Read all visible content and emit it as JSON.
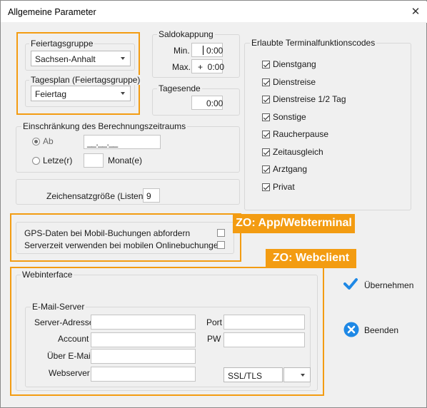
{
  "window": {
    "title": "Allgemeine Parameter",
    "close_glyph": "✕"
  },
  "feiertagsgruppe": {
    "label": "Feiertagsgruppe",
    "value": "Sachsen-Anhalt"
  },
  "tagesplan": {
    "label": "Tagesplan (Feiertagsgruppe)",
    "value": "Feiertag"
  },
  "saldokappung": {
    "label": "Saldokappung",
    "min_label": "Min.",
    "min_value": "0:00",
    "max_label": "Max.",
    "max_value": "+  0:00"
  },
  "tagesende": {
    "label": "Tagesende",
    "value": "0:00"
  },
  "einschraenkung": {
    "label": "Einschränkung des Berechnungszeitraums",
    "ab_label": "Ab",
    "ab_value": "__.__.__",
    "letzte_label": "Letze(r)",
    "letzte_value": "",
    "monat_label": "Monat(e)"
  },
  "zeichensatz": {
    "label": "Zeichensatzgröße (Listen)",
    "value": "9"
  },
  "terminal": {
    "label": "Erlaubte Terminalfunktionscodes",
    "items": [
      {
        "label": "Dienstgang",
        "checked": true
      },
      {
        "label": "Dienstreise",
        "checked": true
      },
      {
        "label": "Dienstreise 1/2 Tag",
        "checked": true
      },
      {
        "label": "Sonstige",
        "checked": true
      },
      {
        "label": "Raucherpause",
        "checked": true
      },
      {
        "label": "Zeitausgleich",
        "checked": true
      },
      {
        "label": "Arztgang",
        "checked": true
      },
      {
        "label": "Privat",
        "checked": true
      }
    ]
  },
  "gps": {
    "label": "GPS-Daten bei Mobil-Buchungen abfordern",
    "checked": false
  },
  "serverzeit": {
    "label": "Serverzeit verwenden bei mobilen Onlinebuchungen",
    "checked": false
  },
  "callouts": {
    "app": "ZO: App/Webterminal",
    "web": "ZO: Webclient"
  },
  "webinterface": {
    "label": "Webinterface",
    "email_label": "E-Mail-Server",
    "server_label": "Server-Adresse",
    "server_value": "",
    "port_label": "Port",
    "port_value": "",
    "account_label": "Account",
    "account_value": "",
    "pw_label": "PW",
    "pw_value": "",
    "ueber_label": "Über E-Mail",
    "ueber_value": "",
    "webserver_label": "Webserver",
    "webserver_value": "",
    "ssl_value": "SSL/TLS",
    "ssl2_value": ""
  },
  "buttons": {
    "uebernehmen": "Übernehmen",
    "beenden": "Beenden"
  },
  "colors": {
    "accent": "#f39c12",
    "check_blue": "#1e88e5"
  }
}
